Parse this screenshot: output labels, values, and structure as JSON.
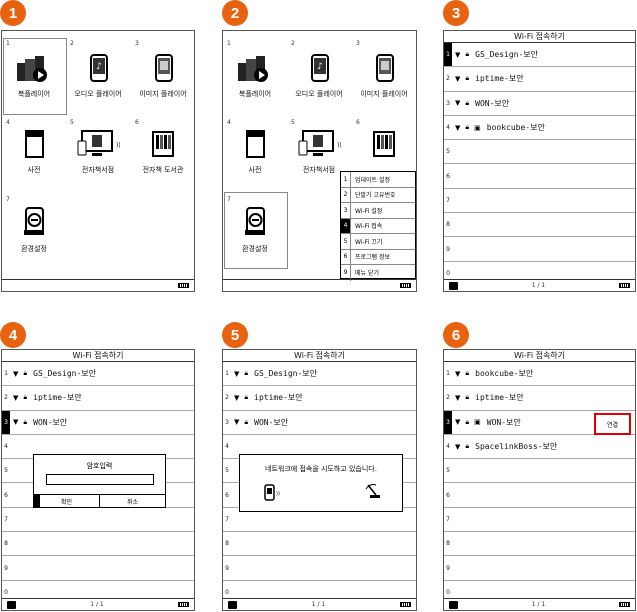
{
  "steps": [
    "1",
    "2",
    "3",
    "4",
    "5",
    "6"
  ],
  "home": {
    "items": [
      {
        "num": "1",
        "label": "북플레이어"
      },
      {
        "num": "2",
        "label": "오디오 플레이어"
      },
      {
        "num": "3",
        "label": "이미지 플레이어"
      },
      {
        "num": "4",
        "label": "사전"
      },
      {
        "num": "5",
        "label": "전자책서점"
      },
      {
        "num": "6",
        "label": "전자책 도서관"
      },
      {
        "num": "7",
        "label": "환경설정"
      }
    ],
    "icon_texts": {
      "dictionary": "DICTIONARY",
      "library": "LIBRARY",
      "setting": "SETTING"
    }
  },
  "menu": {
    "items": [
      {
        "num": "1",
        "label": "업데이트 설정"
      },
      {
        "num": "2",
        "label": "단말기 고유번호"
      },
      {
        "num": "3",
        "label": "Wi-Fi 설정"
      },
      {
        "num": "4",
        "label": "Wi-Fi 접속"
      },
      {
        "num": "5",
        "label": "Wi-Fi 끄기"
      },
      {
        "num": "6",
        "label": "프로그램 정보"
      },
      {
        "num": "9",
        "label": "메뉴 닫기"
      }
    ]
  },
  "wifi": {
    "title": "Wi-Fi 접속하기",
    "page": "1 / 1",
    "row_numbers": [
      "1",
      "2",
      "3",
      "4",
      "5",
      "6",
      "7",
      "8",
      "9",
      "0"
    ],
    "networks_a": [
      "GS_Design-보안",
      "iptime-보안",
      "WON-보안",
      "bookcube-보안"
    ],
    "networks_b": [
      "bookcube-보안",
      "iptime-보안",
      "WON-보안",
      "SpacelinkBoss-보안"
    ],
    "password_dialog": {
      "title": "암호입력",
      "confirm": "확인",
      "cancel": "취소"
    },
    "connecting_message": "네트워크에 접속을 시도하고 있습니다.",
    "connect_button": "연결"
  },
  "colors": {
    "step_badge": "#e8630f",
    "highlight": "#e00000"
  }
}
